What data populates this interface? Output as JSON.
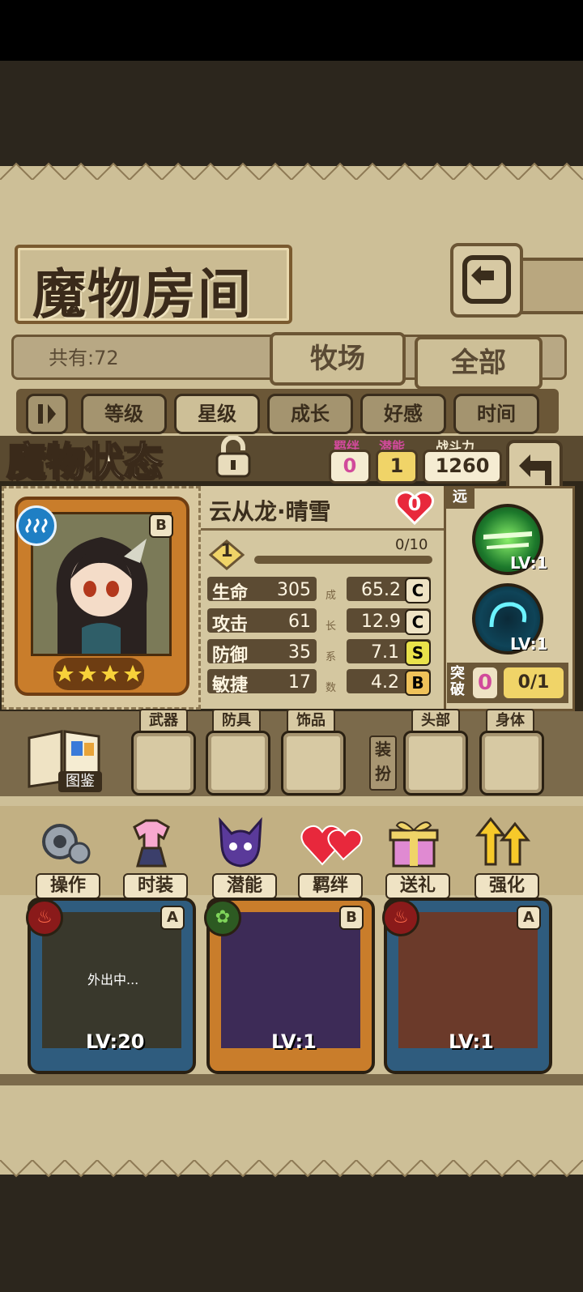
{
  "header": {
    "title": "魔物房间",
    "back_icon": "return-arrow-icon",
    "count_text": "共有:72",
    "tab_farm": "牧场",
    "tab_all": "全部"
  },
  "sort": {
    "toggle_icon": "pause-toggle-icon",
    "items": [
      {
        "label": "等级",
        "selected": false
      },
      {
        "label": "星级",
        "selected": true
      },
      {
        "label": "成长",
        "selected": false
      },
      {
        "label": "好感",
        "selected": false
      },
      {
        "label": "时间",
        "selected": false
      }
    ]
  },
  "status": {
    "title": "魔物状态",
    "lock_icon": "padlock-open-icon",
    "bond_label": "羁绊",
    "bond_value": "0",
    "potential_label": "潜能",
    "potential_value": "1",
    "power_label": "战斗力",
    "power_value": "1260",
    "back_icon": "return-arrow-icon"
  },
  "monster": {
    "name": "云从龙·晴雪",
    "rarity": "B",
    "element_icon": "water-wave-icon",
    "stars": 4,
    "affection": "0",
    "level_badge": "1",
    "exp_text": "0/10",
    "exp_fraction": 0.0,
    "stats": [
      {
        "label": "生命",
        "value": "305",
        "growth": "65.2",
        "grade": "C",
        "grade_color": "#efe3c4"
      },
      {
        "label": "攻击",
        "value": "61",
        "growth": "12.9",
        "grade": "C",
        "grade_color": "#efe3c4"
      },
      {
        "label": "防御",
        "value": "35",
        "growth": "7.1",
        "grade": "S",
        "grade_color": "#e9e24a"
      },
      {
        "label": "敏捷",
        "value": "17",
        "growth": "4.2",
        "grade": "B",
        "grade_color": "#efc25a"
      }
    ],
    "growth_vertical_label": [
      "成",
      "长",
      "系",
      "数"
    ]
  },
  "skills": {
    "range_label": "远",
    "list": [
      {
        "icon": "green-slash-skill-icon",
        "level": "LV:1"
      },
      {
        "icon": "cyan-swirl-skill-icon",
        "level": "LV:1"
      }
    ],
    "breakthrough_label": "突破",
    "breakthrough_count": "0",
    "breakthrough_progress": "0/1"
  },
  "equipment": {
    "codex_label": "图鉴",
    "slots_left": [
      "武器",
      "防具",
      "饰品"
    ],
    "dress_label": "装扮",
    "slots_right": [
      "头部",
      "身体"
    ]
  },
  "actions": [
    {
      "label": "操作",
      "icon": "gear-icon"
    },
    {
      "label": "时装",
      "icon": "outfit-icon"
    },
    {
      "label": "潜能",
      "icon": "demon-head-icon"
    },
    {
      "label": "羁绊",
      "icon": "hearts-icon"
    },
    {
      "label": "送礼",
      "icon": "gift-box-icon"
    },
    {
      "label": "强化",
      "icon": "up-arrows-icon"
    }
  ],
  "cards": [
    {
      "level": "LV:20",
      "grade": "A",
      "status": "外出中...",
      "element_icon": "fire-icon"
    },
    {
      "level": "LV:1",
      "grade": "B",
      "status": "",
      "element_icon": "leaf-icon"
    },
    {
      "level": "LV:1",
      "grade": "A",
      "status": "",
      "element_icon": "fire-icon"
    }
  ]
}
